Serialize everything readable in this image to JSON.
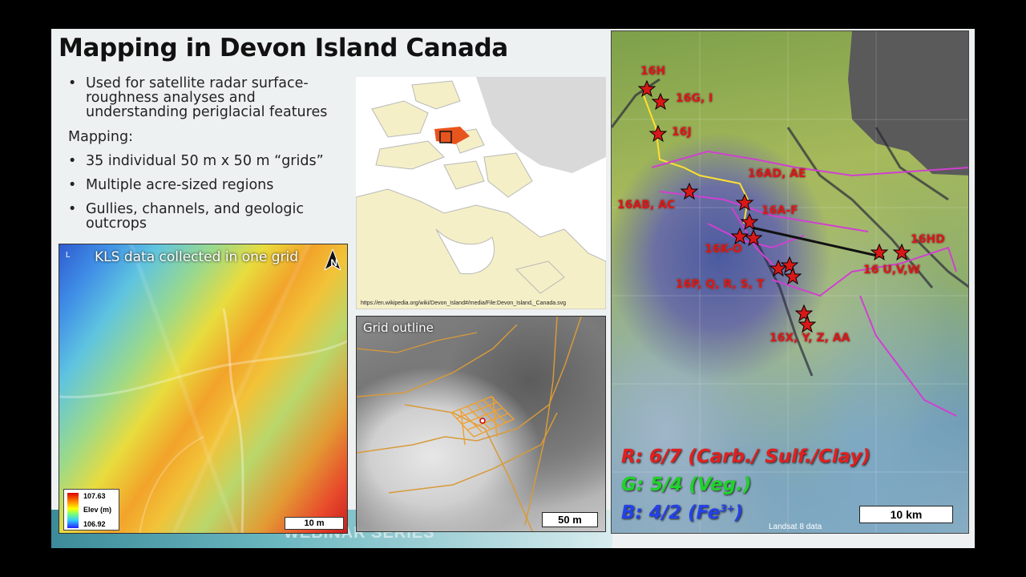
{
  "slide": {
    "title": "Mapping in Devon Island Canada",
    "footer": "WEBINAR SERIES",
    "bullets_top": [
      "Used for satellite radar surface-roughness analyses and understanding periglacial features"
    ],
    "bullet_line1": "Used for satellite radar surface-",
    "bullet_line2": "roughness analyses and",
    "bullet_line3": "understanding periglacial features",
    "mapping_heading": "Mapping:",
    "bullet_2": "35 individual 50 m x 50 m “grids”",
    "bullet_3": "Multiple acre-sized regions",
    "bullet_4a": "Gullies, channels, and geologic",
    "bullet_4b": "outcrops",
    "bullet_glyph": "•"
  },
  "kls": {
    "title": "KLS data collected in one grid",
    "corner": "L",
    "north": "N",
    "legend_max": "107.63",
    "legend_label": "Elev (m)",
    "legend_min": "106.92",
    "scale": "10 m"
  },
  "canada_map": {
    "source_url": "https://en.wikipedia.org/wiki/Devon_Island#/media/File:Devon_Island,_Canada.svg",
    "highlight_color": "#e8541e"
  },
  "grid_photo": {
    "title": "Grid outline",
    "scale": "50 m",
    "outline_color": "#e0a040"
  },
  "landsat": {
    "sites": [
      "16H",
      "16G, I",
      "16J",
      "16AD, AE",
      "16AB, AC",
      "16A-F",
      "16K-O",
      "16HD",
      "16 U,V,W",
      "16P, Q, R, S, T",
      "16X, Y, Z, AA"
    ],
    "band_r": "R: 6/7 (Carb./ Sulf./Clay)",
    "band_g": "G: 5/4 (Veg.)",
    "band_b_prefix": "B: 4/2 (Fe",
    "band_b_sup": "3+",
    "band_b_suffix": ")",
    "credit": "Landsat 8 data",
    "scale": "10  km",
    "marker_color": "#d81818"
  }
}
